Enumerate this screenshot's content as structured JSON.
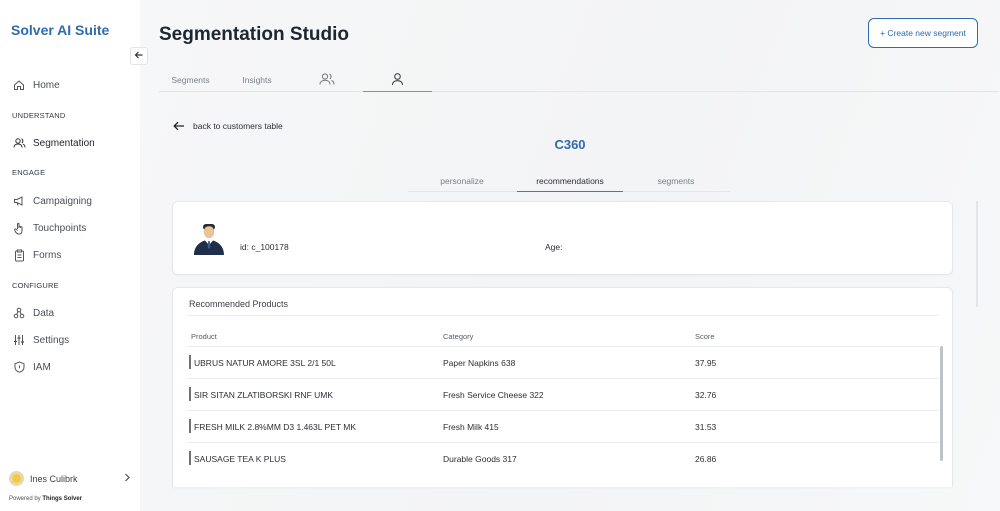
{
  "app": {
    "brand": "Solver AI Suite"
  },
  "sidebar": {
    "home": "Home",
    "sections": {
      "understand": "UNDERSTAND",
      "engage": "ENGAGE",
      "configure": "CONFIGURE"
    },
    "items": {
      "segmentation": "Segmentation",
      "campaigning": "Campaigning",
      "touchpoints": "Touchpoints",
      "forms": "Forms",
      "data": "Data",
      "settings": "Settings",
      "iam": "IAM"
    },
    "user": "Ines Culibrk",
    "powered_prefix": "Powered by",
    "powered_brand": "Things Solver"
  },
  "header": {
    "title": "Segmentation Studio",
    "create_button": "+ Create new segment",
    "tabs": {
      "segments": "Segments",
      "insights": "Insights"
    }
  },
  "customer": {
    "back_link": "back to customers table",
    "heading": "C360",
    "tabs": {
      "personalize": "personalize",
      "recommendations": "recommendations",
      "segments": "segments"
    },
    "id_label": "id: c_100178",
    "age_label": "Age:"
  },
  "recommended": {
    "title": "Recommended Products",
    "columns": {
      "product": "Product",
      "category": "Category",
      "score": "Score"
    },
    "rows": [
      {
        "product": "UBRUS NATUR AMORE 3SL 2/1 50L",
        "category": "Paper Napkins 638",
        "score": "37.95"
      },
      {
        "product": "SIR SITAN ZLATIBORSKI RNF UMK",
        "category": "Fresh Service Cheese 322",
        "score": "32.76"
      },
      {
        "product": "FRESH MILK 2.8%MM D3 1.463L PET MK",
        "category": "Fresh Milk 415",
        "score": "31.53"
      },
      {
        "product": "SAUSAGE TEA K PLUS",
        "category": "Durable Goods 317",
        "score": "26.86"
      }
    ]
  },
  "colors": {
    "accent": "#2e6bb0",
    "text": "#2b2f36",
    "muted": "#7a7f87"
  }
}
